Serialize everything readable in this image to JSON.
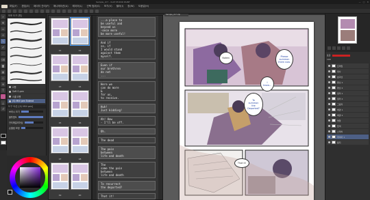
{
  "window": {
    "title": "Sample_ch7 - CLIP STUDIO PAINT",
    "controls": [
      "—",
      "□",
      "✕"
    ]
  },
  "menu": {
    "items": [
      "파일(F)",
      "편집(E)",
      "페이지 관리(P)",
      "애니메이션(A)",
      "레이어(L)",
      "선택 범위(S)",
      "보기(V)",
      "필터(I)",
      "창(W)",
      "도움말(H)"
    ]
  },
  "toolbar": {
    "button_count": 18
  },
  "tools": {
    "icons": [
      "zoom-icon",
      "move-icon",
      "select-icon",
      "eyedropper-icon",
      "pen-icon",
      "brush-icon",
      "airbrush-icon",
      "eraser-icon",
      "fill-icon",
      "gradient-icon",
      "figure-icon",
      "frame-icon",
      "text-icon",
      "balloon-icon",
      "ruler-icon",
      "correct-icon"
    ],
    "icon_glyphs": [
      "⌕",
      "✥",
      "▭",
      "⊙",
      "✎",
      "✐",
      "∴",
      "⌫",
      "◙",
      "▦",
      "◇",
      "⊞",
      "T",
      "◯",
      "⟂",
      "↺"
    ],
    "active_index": 4,
    "pink_index": 13
  },
  "brush_panel": {
    "title": "보조 도구 [펜]",
    "brushes": [
      {
        "label": "G펜",
        "selected": false
      },
      {
        "label": "Soft G-pen",
        "selected": false
      },
      {
        "label": "스쿨 G펜",
        "selected": false
      },
      {
        "label": "(S) Milli pen Extend",
        "selected": true
      }
    ],
    "property_title": "도구 속성 [(S) Milli pen]",
    "properties": [
      {
        "label": "브러시 크기",
        "value": 0.35
      },
      {
        "label": "불투명도",
        "value": 1.0
      },
      {
        "label": "안티에일리어싱",
        "value": 0.5
      },
      {
        "label": "손떨림 보정",
        "value": 0.2
      }
    ]
  },
  "color": {
    "foreground": "#111111",
    "background": "#ffffff",
    "hue": "#8b2be2"
  },
  "page_manager": {
    "pairs": [
      {
        "labels": [
          "11",
          "12"
        ]
      },
      {
        "labels": [
          "13",
          "14"
        ]
      },
      {
        "labels": [
          "15",
          "16"
        ]
      },
      {
        "labels": [
          "17",
          "18"
        ]
      },
      {
        "labels": [
          "19",
          "20"
        ]
      }
    ]
  },
  "story_editor": {
    "blocks": [
      "...a place to\nbe useful and\nbeyond us\n-once more\nbe more useful!",
      "And if\nso, if\nI would stand\nagainst them\nmyself.",
      "Even if\nour brethren\ndo not\n...",
      "Here we\ncan do more\n&\nfor us,\nto receive.",
      "Huh!\nJust kidding!",
      "Ah! Haw\n- I'll be off.",
      "Oh.",
      "The dead",
      "The pain\nbetween\nlife and death",
      "The\nsame the pain\nbetween\nlife and death",
      "To resurrect\nthe departed?",
      "That it!"
    ]
  },
  "canvas": {
    "tab_label": "Sample_ch7.clip",
    "bubbles": [
      "Noted.",
      "Please\nsummon\nthem now.",
      "I\nknow...",
      "To\nsummon\nthe\nDeparted?",
      "That it!"
    ]
  },
  "layers": {
    "blend_mode": "표준",
    "opacity": "100",
    "items": [
      {
        "name": "프레임",
        "selected": false
      },
      {
        "name": "대사",
        "selected": false
      },
      {
        "name": "효과선",
        "selected": false
      },
      {
        "name": "펜선 1",
        "selected": false
      },
      {
        "name": "펜선 2",
        "selected": false
      },
      {
        "name": "컬러 1",
        "selected": false
      },
      {
        "name": "컬러 2",
        "selected": false
      },
      {
        "name": "그림자",
        "selected": false
      },
      {
        "name": "배경 1",
        "selected": false
      },
      {
        "name": "배경 2",
        "selected": false
      },
      {
        "name": "명암",
        "selected": false
      },
      {
        "name": "밑색",
        "selected": false
      },
      {
        "name": "스케치",
        "selected": false
      },
      {
        "name": "레이어 1",
        "selected": true
      },
      {
        "name": "용지",
        "selected": false
      }
    ]
  }
}
